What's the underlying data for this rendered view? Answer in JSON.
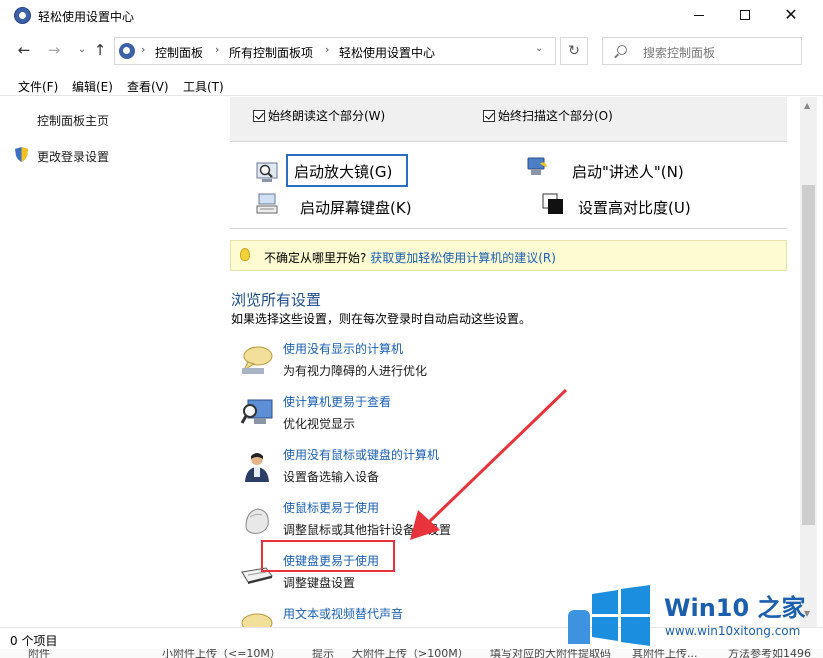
{
  "window": {
    "title": "轻松使用设置中心",
    "minimize_label": "—",
    "maximize_label": "☐",
    "close_label": "✕"
  },
  "nav": {
    "back": "←",
    "forward": "→",
    "history_drop": "⌄",
    "up": "↑",
    "breadcrumbs": [
      "控制面板",
      "所有控制面板项",
      "轻松使用设置中心"
    ],
    "breadcrumb_separator": "›",
    "address_drop": "⌄",
    "refresh": "↻",
    "search_placeholder": "搜索控制面板"
  },
  "menu": {
    "items": [
      "文件(F)",
      "编辑(E)",
      "查看(V)",
      "工具(T)"
    ]
  },
  "sidebar": {
    "home": "控制面板主页",
    "change_login": "更改登录设置"
  },
  "quick_access": {
    "always_read": "始终朗读这个部分(W)",
    "always_scan": "始终扫描这个部分(O)",
    "tools": {
      "magnifier": "启动放大镜(G)",
      "narrator": "启动\"讲述人\"(N)",
      "osk": "启动屏幕键盘(K)",
      "high_contrast": "设置高对比度(U)"
    }
  },
  "tip": {
    "text": "不确定从哪里开始?",
    "link": "获取更加轻松使用计算机的建议(R)"
  },
  "browse": {
    "title": "浏览所有设置",
    "desc": "如果选择这些设置，则在每次登录时自动启动这些设置。",
    "items": [
      {
        "link": "使用没有显示的计算机",
        "desc": "为有视力障碍的人进行优化",
        "icon": "speech-bubble-icon"
      },
      {
        "link": "使计算机更易于查看",
        "desc": "优化视觉显示",
        "icon": "monitor-magnifier-icon"
      },
      {
        "link": "使用没有鼠标或键盘的计算机",
        "desc": "设置备选输入设备",
        "icon": "person-icon"
      },
      {
        "link": "使鼠标更易于使用",
        "desc": "调整鼠标或其他指针设备的设置",
        "icon": "mouse-icon"
      },
      {
        "link": "使键盘更易于使用",
        "desc": "调整键盘设置",
        "icon": "keyboard-icon"
      },
      {
        "link": "用文本或视频替代声音",
        "desc": "",
        "icon": "caption-bubble-icon"
      }
    ]
  },
  "status": {
    "items_count": "0 个项目"
  },
  "underlap": {
    "text1": "附件",
    "text2": "小附件上传（<=10M）",
    "text3": "提示",
    "text4": "大附件上传（>100M）",
    "text5": "填写对应的大附件提取码",
    "text6": "其附件上传...",
    "text7": "方法参考如1496"
  },
  "watermark": {
    "title": "Win10 之家",
    "url": "www.win10xitong.com"
  },
  "colors": {
    "link": "#1a5fb4",
    "annotation": "#e8323c",
    "watermark": "#1b5fae"
  }
}
